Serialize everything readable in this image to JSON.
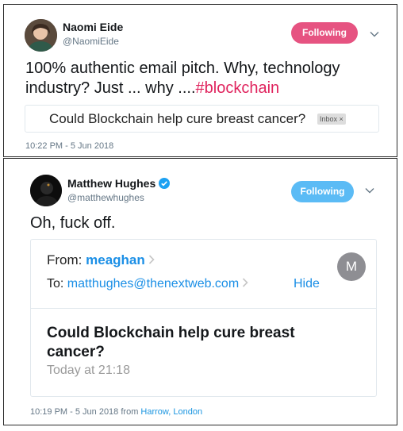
{
  "tweet1": {
    "name": "Naomi Eide",
    "handle": "@NaomiEide",
    "follow_label": "Following",
    "text_main": "100% authentic email pitch. Why, technology industry? Just ... why ....",
    "hashtag": "#blockchain",
    "card_subject": "Could Blockchain help cure breast cancer?",
    "card_tag": "Inbox ×",
    "timestamp": "10:22 PM - 5 Jun 2018",
    "follow_color": "#e0245e"
  },
  "tweet2": {
    "name": "Matthew Hughes",
    "handle": "@matthewhughes",
    "follow_label": "Following",
    "text": "Oh, fuck off.",
    "email": {
      "from_label": "From:",
      "sender": "meaghan",
      "to_label": "To:",
      "to_address": "matthughes@thenextweb.com",
      "hide_label": "Hide",
      "avatar_letter": "M",
      "subject": "Could Blockchain help cure breast cancer?",
      "time": "Today at 21:18"
    },
    "timestamp": "10:19 PM - 5 Jun 2018 from ",
    "place": "Harrow, London",
    "follow_color": "#1da1f2"
  },
  "icons": [
    "verified-badge-icon",
    "chevron-down-icon",
    "chevron-right-icon"
  ]
}
